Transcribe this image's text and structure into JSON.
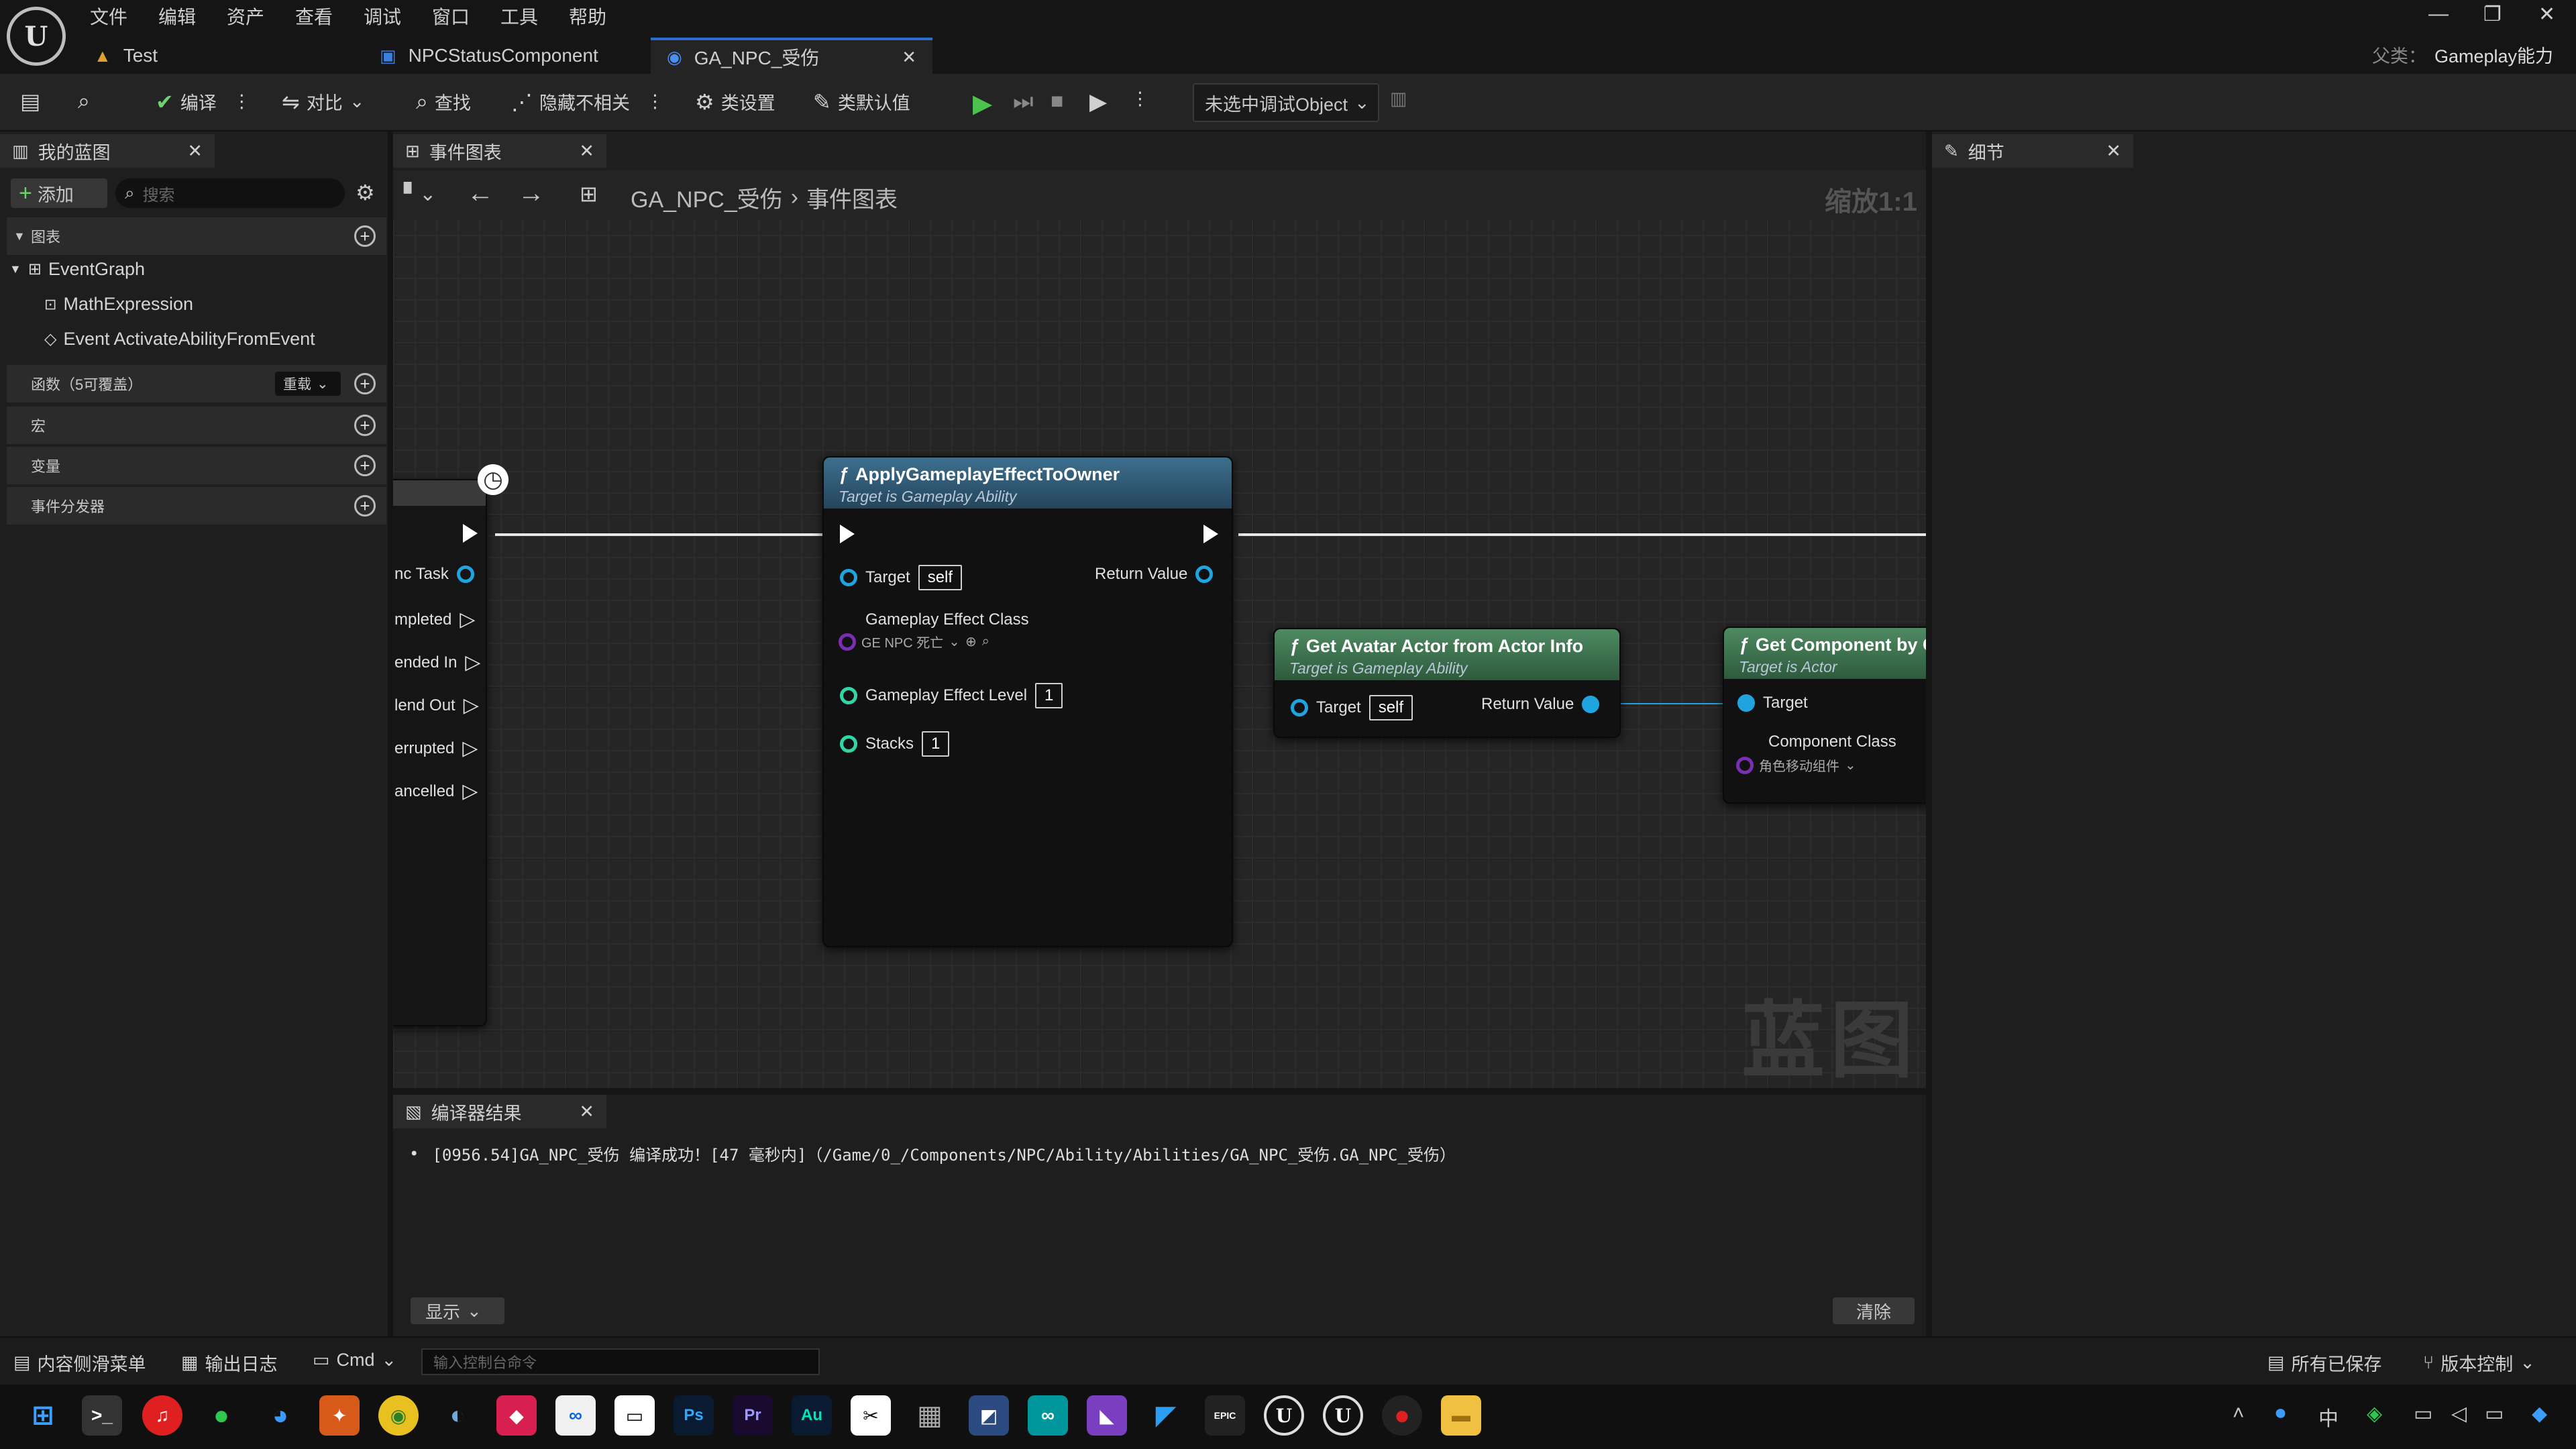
{
  "menu": [
    "文件",
    "编辑",
    "资产",
    "查看",
    "调试",
    "窗口",
    "工具",
    "帮助"
  ],
  "tabs": [
    {
      "label": "Test"
    },
    {
      "label": "NPCStatusComponent"
    },
    {
      "label": "GA_NPC_受伤"
    }
  ],
  "parent_class": {
    "label": "父类：",
    "value": "Gameplay能力"
  },
  "toolbar": {
    "compile": "编译",
    "diff": "对比",
    "find": "查找",
    "hide_unrelated": "隐藏不相关",
    "class_settings": "类设置",
    "class_defaults": "类默认值",
    "debug_object": "未选中调试Object"
  },
  "my_blueprint": {
    "tab": "我的蓝图",
    "add": "添加",
    "search_placeholder": "搜索",
    "graphs_header": "图表",
    "graph_items": [
      "EventGraph",
      "MathExpression",
      "Event ActivateAbilityFromEvent"
    ],
    "functions_header": "函数（5可覆盖）",
    "override": "重载",
    "macros": "宏",
    "variables": "变量",
    "event_dispatchers": "事件分发器"
  },
  "event_graph": {
    "tab": "事件图表",
    "breadcrumb": [
      "GA_NPC_受伤",
      "事件图表"
    ],
    "zoom": "缩放1:1",
    "watermark": "蓝图",
    "partial_pins": [
      "nc Task",
      "mpleted",
      "ended In",
      "lend Out",
      "errupted",
      "ancelled"
    ]
  },
  "nodes": {
    "apply": {
      "title": "ApplyGameplayEffectToOwner",
      "subtitle": "Target is Gameplay Ability",
      "target": "Target",
      "self": "self",
      "return": "Return Value",
      "effect_class": "Gameplay Effect Class",
      "effect_value": "GE NPC 死亡",
      "effect_level": "Gameplay Effect Level",
      "level_value": "1",
      "stacks": "Stacks",
      "stacks_value": "1"
    },
    "avatar": {
      "title": "Get Avatar Actor from Actor Info",
      "subtitle": "Target is Gameplay Ability",
      "target": "Target",
      "self": "self",
      "return": "Return Value"
    },
    "component": {
      "title": "Get Component by C",
      "subtitle": "Target is Actor",
      "target": "Target",
      "component_class": "Component Class",
      "class_value": "角色移动组件"
    }
  },
  "compiler": {
    "tab": "编译器结果",
    "message": "[0956.54]GA_NPC_受伤 编译成功！[47 毫秒内]（/Game/0_/Components/NPC/Ability/Abilities/GA_NPC_受伤.GA_NPC_受伤）",
    "show": "显示",
    "clear": "清除"
  },
  "details": {
    "tab": "细节"
  },
  "statusbar": {
    "content_drawer": "内容侧滑菜单",
    "output_log": "输出日志",
    "cmd": "Cmd",
    "console_placeholder": "输入控制台命令",
    "all_saved": "所有已保存",
    "source_control": "版本控制"
  },
  "taskbar": {
    "icons": [
      "windows-start",
      "terminal",
      "netease-music",
      "wechat",
      "edge",
      "butterfly",
      "chrome",
      "steam",
      "app-red",
      "meta",
      "obs",
      "photoshop",
      "premiere",
      "audition",
      "capcut",
      "calculator",
      "app-blue",
      "arduino",
      "visual-studio",
      "vscode",
      "epic-games",
      "unreal",
      "unreal-2",
      "record",
      "file-explorer"
    ],
    "labels": {
      "ps": "Ps",
      "pr": "Pr",
      "au": "Au",
      "epic": "EPIC",
      "ime": "中"
    }
  },
  "colors": {
    "accent": "#2a6fd0",
    "func_node_header": "#2e5f7e",
    "pure_node_header": "#3f7a56",
    "exec_play": "#4cc34c",
    "object_pin": "#20a4e0"
  }
}
